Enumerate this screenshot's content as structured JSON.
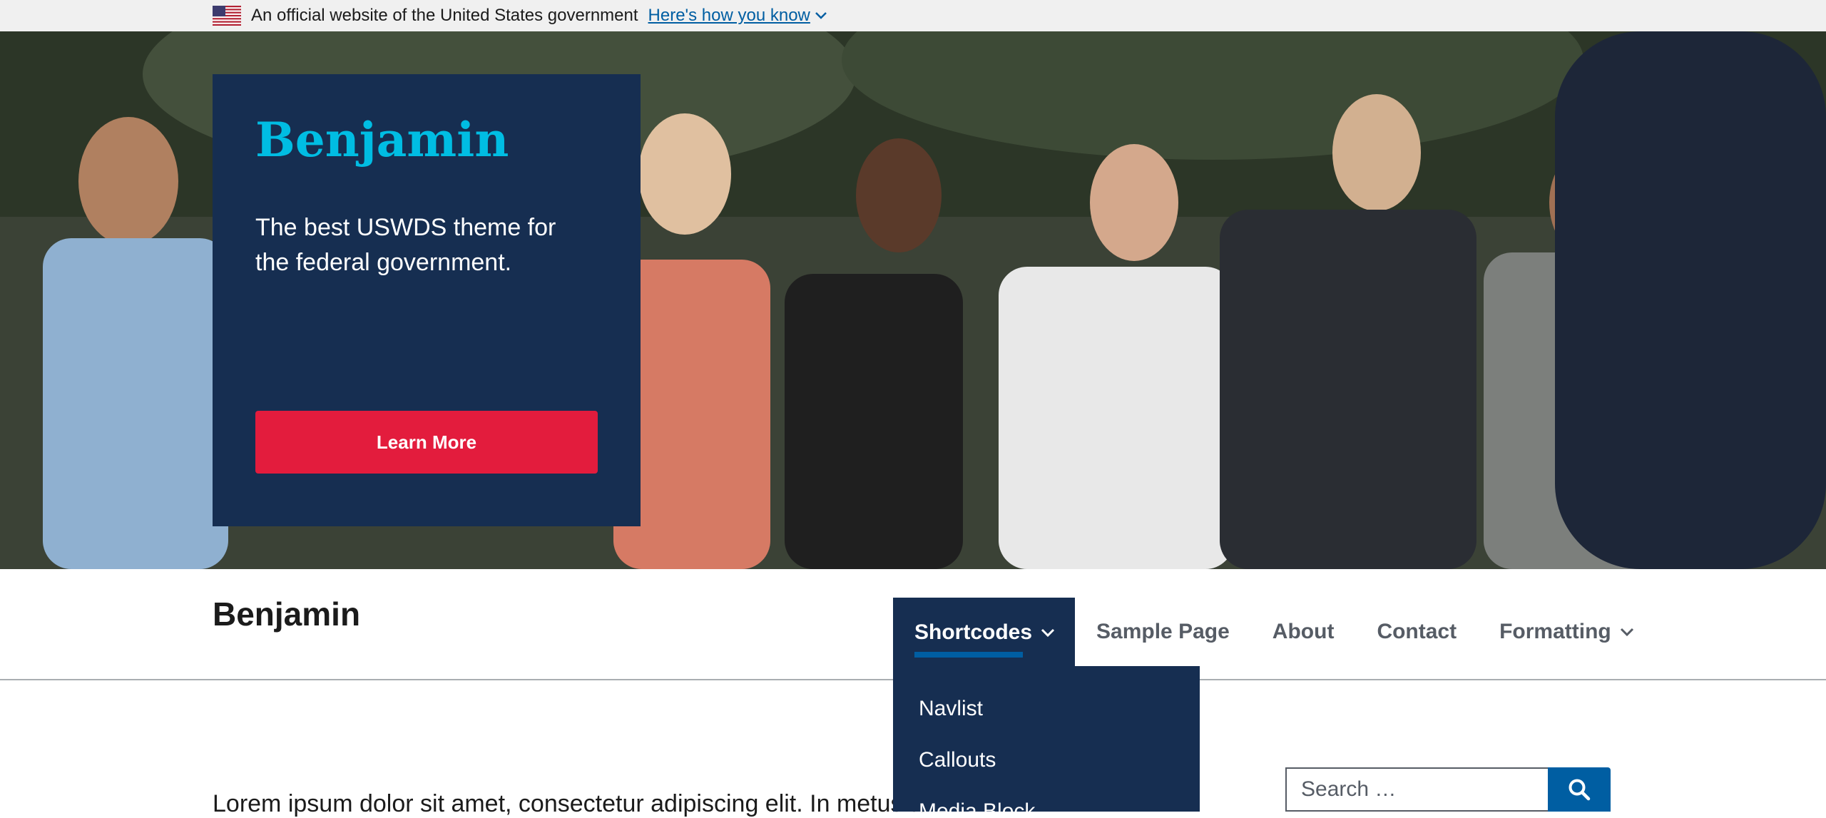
{
  "gov_banner": {
    "text": "An official website of the United States government",
    "link": "Here's how you know"
  },
  "hero": {
    "title": "Benjamin",
    "subtitle": "The best USWDS theme for the federal government.",
    "button": "Learn More"
  },
  "header": {
    "logo": "Benjamin",
    "nav": [
      {
        "label": "Shortcodes",
        "has_dropdown": true,
        "active": true
      },
      {
        "label": "Sample Page",
        "has_dropdown": false
      },
      {
        "label": "About",
        "has_dropdown": false
      },
      {
        "label": "Contact",
        "has_dropdown": false
      },
      {
        "label": "Formatting",
        "has_dropdown": true
      }
    ]
  },
  "dropdown": {
    "items": [
      "Navlist",
      "Callouts",
      "Media Block"
    ]
  },
  "main": {
    "text": "Lorem ipsum dolor sit amet, consectetur adipiscing elit. In metus to"
  },
  "search": {
    "placeholder": "Search …",
    "icon": "search-icon"
  },
  "colors": {
    "primary_dark": "#162e51",
    "accent_cyan": "#00bde3",
    "button_red": "#e31c3d",
    "link_blue": "#005ea2"
  }
}
